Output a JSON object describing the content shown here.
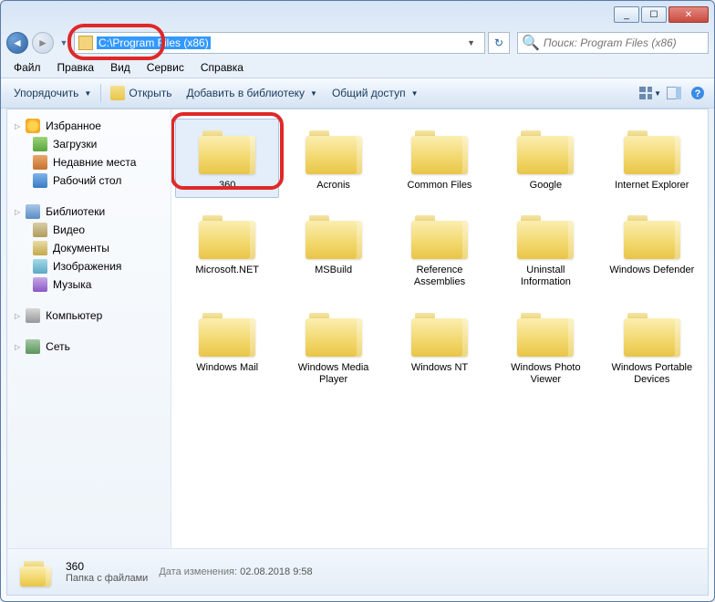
{
  "window": {
    "min_tip": "_",
    "max_tip": "☐",
    "close_tip": "✕"
  },
  "address": {
    "path": "C:\\Program Files (x86)",
    "search_placeholder": "Поиск: Program Files (x86)"
  },
  "menu": {
    "file": "Файл",
    "edit": "Правка",
    "view": "Вид",
    "service": "Сервис",
    "help": "Справка"
  },
  "toolbar": {
    "organize": "Упорядочить",
    "open": "Открыть",
    "add_to_lib": "Добавить в библиотеку",
    "share": "Общий доступ"
  },
  "sidebar": {
    "fav": "Избранное",
    "downloads": "Загрузки",
    "recent": "Недавние места",
    "desktop": "Рабочий стол",
    "libs": "Библиотеки",
    "video": "Видео",
    "docs": "Документы",
    "pics": "Изображения",
    "music": "Музыка",
    "computer": "Компьютер",
    "network": "Сеть"
  },
  "folders": [
    {
      "name": "360",
      "selected": true,
      "highlight": true
    },
    {
      "name": "Acronis"
    },
    {
      "name": "Common Files"
    },
    {
      "name": "Google"
    },
    {
      "name": "Internet Explorer"
    },
    {
      "name": "Microsoft.NET"
    },
    {
      "name": "MSBuild"
    },
    {
      "name": "Reference Assemblies"
    },
    {
      "name": "Uninstall Information"
    },
    {
      "name": "Windows Defender"
    },
    {
      "name": "Windows Mail"
    },
    {
      "name": "Windows Media Player"
    },
    {
      "name": "Windows NT"
    },
    {
      "name": "Windows Photo Viewer"
    },
    {
      "name": "Windows Portable Devices"
    }
  ],
  "status": {
    "name": "360",
    "type": "Папка с файлами",
    "modified_label": "Дата изменения:",
    "modified_value": "02.08.2018 9:58"
  }
}
